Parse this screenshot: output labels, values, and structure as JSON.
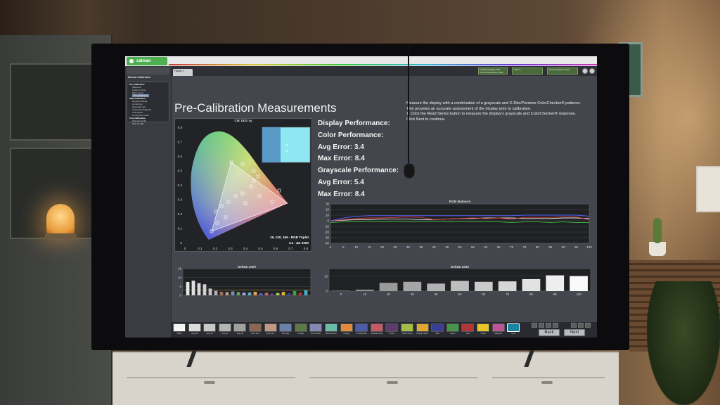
{
  "app": {
    "brand": "calman",
    "sidebar_title": "Manual Calibration",
    "tab": "History 1"
  },
  "sidebar": {
    "items": [
      {
        "label": "Pre-Calibration",
        "kind": "section"
      },
      {
        "label": "Welcome",
        "kind": "item"
      },
      {
        "label": "Session Setup",
        "kind": "item"
      },
      {
        "label": "Meter Setup",
        "kind": "item"
      },
      {
        "label": "Pre-Calibration",
        "kind": "selected"
      },
      {
        "label": "SDR Calibration",
        "kind": "section"
      },
      {
        "label": "Dynamic Range",
        "kind": "item"
      },
      {
        "label": "Luminance",
        "kind": "item"
      },
      {
        "label": "Grayscale 2pt",
        "kind": "item"
      },
      {
        "label": "Grayscale Multipoint",
        "kind": "item"
      },
      {
        "label": "Colorspace",
        "kind": "item"
      },
      {
        "label": "Luminance Check",
        "kind": "item"
      },
      {
        "label": "Post-Calibration",
        "kind": "section"
      },
      {
        "label": "Post-Cal Verify",
        "kind": "item"
      },
      {
        "label": "Side by Side",
        "kind": "item"
      }
    ]
  },
  "hardware": {
    "meter": [
      "X-Rite i1Display 3/3P",
      "Non-PFS (Generic CMF)"
    ],
    "source": "Source",
    "display": "Direct Display Control"
  },
  "page": {
    "title": "Pre-Calibration Measurements",
    "instructions": [
      "Measure the display with a combination of a grayscale and X-Rite/Pantone ColorChecker® patterns.",
      "This provides an accurate assessment of the display prior to calibration.",
      "1. Click the Read Series button to measure the display's grayscale and ColorChecker® response.",
      "Click Next to continue."
    ]
  },
  "performance": {
    "display_heading": "Display Performance:",
    "color_heading": "Color Performance:",
    "color_avg": "Avg Error: 3.4",
    "color_max": "Max Error: 8.4",
    "gray_heading": "Grayscale Performance:",
    "gray_avg": "Avg Error: 5.4",
    "gray_max": "Max Error: 8.4"
  },
  "cie": {
    "title": "CIE 1931 xy",
    "readout1": "16, 130, 156 - RGB Triplet",
    "readout2": "3.2 - ΔE 2000",
    "x_ticks": [
      "0",
      "0.1",
      "0.2",
      "0.3",
      "0.4",
      "0.5",
      "0.6",
      "0.7",
      "0.8"
    ],
    "y_ticks": [
      "0.8",
      "0.7",
      "0.6",
      "0.5",
      "0.4",
      "0.3",
      "0.2",
      "0.1",
      "0"
    ]
  },
  "chart_data": [
    {
      "type": "line",
      "title": "RGB Balance",
      "x": [
        0,
        5,
        10,
        15,
        20,
        25,
        30,
        35,
        40,
        45,
        50,
        55,
        60,
        65,
        70,
        75,
        80,
        85,
        90,
        95,
        100
      ],
      "y_ticks": [
        "30",
        "20",
        "10",
        "0",
        "-10",
        "-20",
        "-30",
        "-40"
      ],
      "ylim": [
        -40,
        30
      ],
      "series": [
        {
          "color": "#e8e8e8",
          "values": [
            0,
            1,
            2,
            2,
            3,
            3,
            3,
            2,
            2,
            3,
            4,
            4,
            5,
            5,
            5,
            4,
            4,
            4,
            5,
            5,
            4
          ]
        },
        {
          "color": "#e04040",
          "values": [
            0,
            2,
            4,
            5,
            5,
            6,
            7,
            6,
            2,
            3,
            4,
            5,
            4,
            5,
            3,
            6,
            6,
            6,
            7,
            7,
            2
          ]
        },
        {
          "color": "#40c040",
          "values": [
            -3,
            -2,
            -2,
            -1,
            -2,
            -1,
            -2,
            -2,
            -1,
            -2,
            -2,
            -2,
            -2,
            -2,
            -3,
            -2,
            -2,
            -3,
            -2,
            -3,
            -3
          ]
        },
        {
          "color": "#5060ff",
          "values": [
            0,
            5,
            8,
            9,
            9,
            9,
            9,
            9,
            9,
            9,
            9,
            9,
            9,
            9,
            9,
            10,
            10,
            10,
            10,
            10,
            8
          ]
        }
      ]
    },
    {
      "type": "bar",
      "title": "DeltaE 2000",
      "y_ticks": [
        "15",
        "10",
        "5",
        "0"
      ],
      "ylim": [
        0,
        15
      ],
      "values": [
        7.5,
        8.2,
        6.8,
        6.2,
        3.8,
        2.5,
        2.0,
        1.8,
        2.2,
        1.8,
        1.5,
        1.6,
        2.0,
        1.2,
        1.4,
        1.0,
        1.3,
        1.9,
        1.1,
        2.4,
        1.5,
        2.8
      ],
      "colors": [
        "#e8e8e8",
        "#e0e0e0",
        "#d8d8d8",
        "#cfcfcf",
        "#c4c4c4",
        "#b0b0b0",
        "#a07060",
        "#c89888",
        "#7090c0",
        "#70a060",
        "#a0a8d8",
        "#60b0c0",
        "#e8a050",
        "#5060c0",
        "#d06070",
        "#7040a0",
        "#b0d050",
        "#e0b030",
        "#4040b0",
        "#40a040",
        "#c03030",
        "#40b0d0"
      ]
    },
    {
      "type": "bar",
      "title": "DeltaE 2000",
      "categories": [
        "0",
        "10",
        "20",
        "30",
        "40",
        "50",
        "60",
        "70",
        "80",
        "90",
        "100"
      ],
      "y_ticks": [
        "10",
        "0"
      ],
      "ylim": [
        0,
        15
      ],
      "values": [
        0.3,
        1.0,
        5.5,
        6.2,
        5.0,
        6.8,
        6.2,
        6.5,
        8.0,
        10.5,
        10.0
      ]
    }
  ],
  "swatches": [
    {
      "label": "White",
      "color": "#f4f4f4"
    },
    {
      "label": "Gray 80",
      "color": "#dcdcdc"
    },
    {
      "label": "Gray 65",
      "color": "#c8c8c8"
    },
    {
      "label": "Gray 50",
      "color": "#b4b4b4"
    },
    {
      "label": "Gray 35",
      "color": "#a0a0a0"
    },
    {
      "label": "Dark Skin",
      "color": "#8a6654"
    },
    {
      "label": "Light Skin",
      "color": "#c49684"
    },
    {
      "label": "Blue Sky",
      "color": "#6a82a8"
    },
    {
      "label": "Foliage",
      "color": "#5a7a48"
    },
    {
      "label": "Blue Flower",
      "color": "#8488b4"
    },
    {
      "label": "Bluish Green",
      "color": "#6abcaa"
    },
    {
      "label": "Orange",
      "color": "#e08a3a"
    },
    {
      "label": "Purplish Blue",
      "color": "#4c5ca8"
    },
    {
      "label": "Moderate Red",
      "color": "#c45a66"
    },
    {
      "label": "Purple",
      "color": "#5c3c6c"
    },
    {
      "label": "Yellow Green",
      "color": "#a4bc46"
    },
    {
      "label": "Orange Yellow",
      "color": "#e0a630"
    },
    {
      "label": "Blue",
      "color": "#3a3e94"
    },
    {
      "label": "Green",
      "color": "#48944a"
    },
    {
      "label": "Red",
      "color": "#b0363a"
    },
    {
      "label": "Yellow",
      "color": "#e6c628"
    },
    {
      "label": "Magenta",
      "color": "#bc5496"
    },
    {
      "label": "Cyan",
      "color": "#1a86a4"
    }
  ],
  "nav": {
    "back": "Back",
    "next": "Next"
  }
}
